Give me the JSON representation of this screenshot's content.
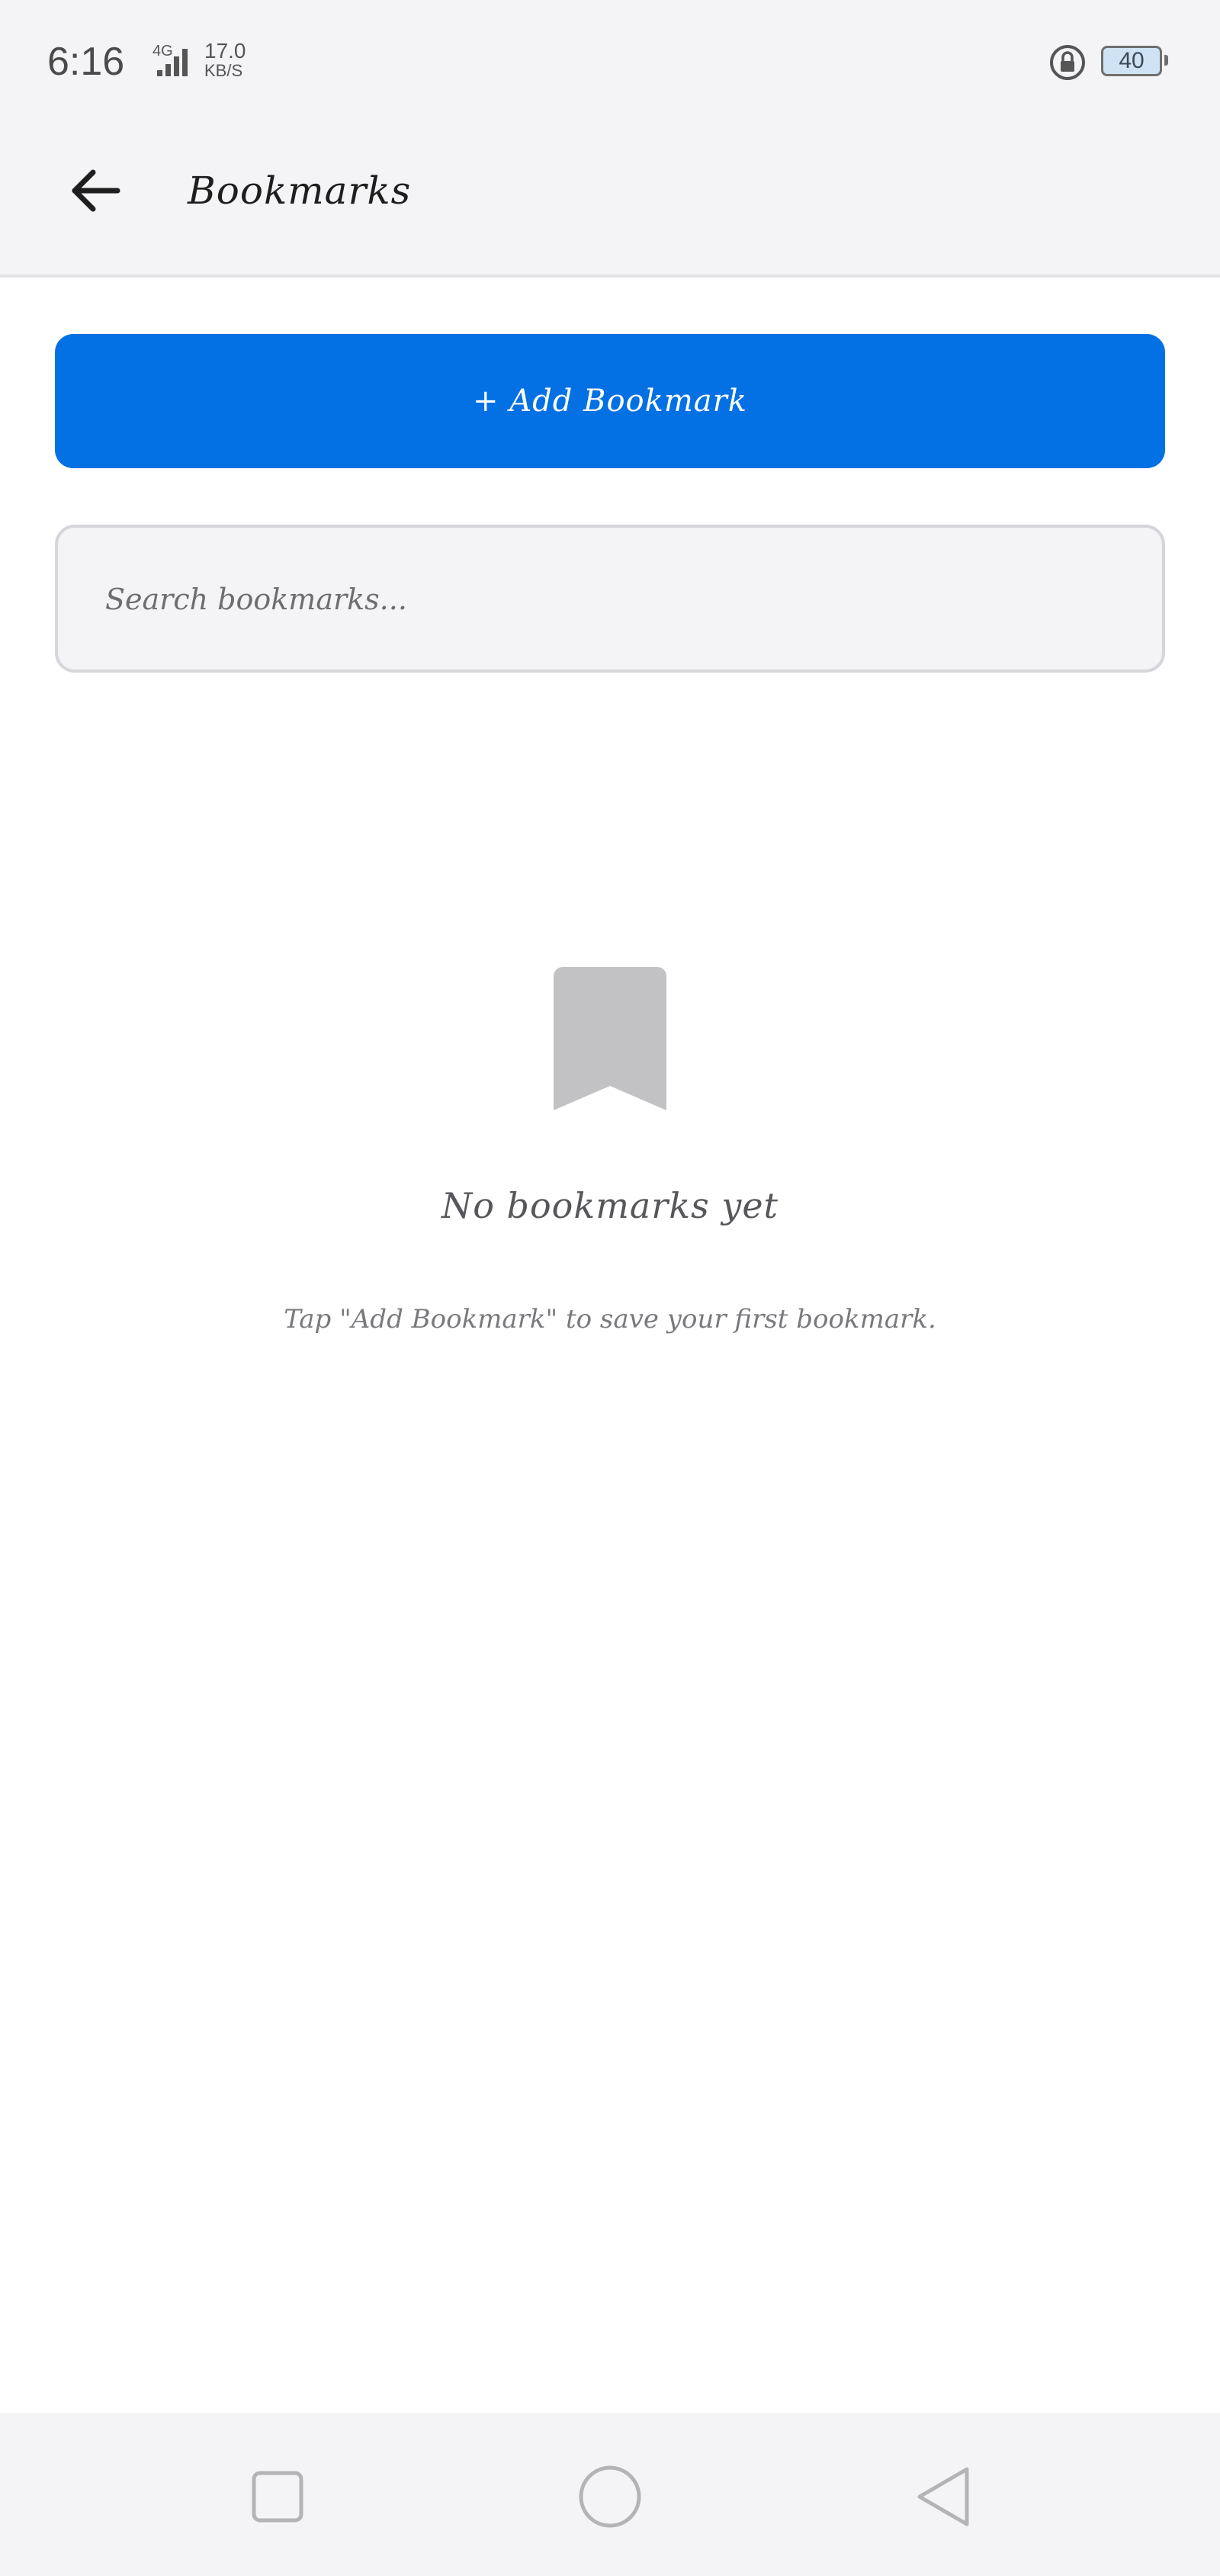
{
  "status_bar": {
    "time": "6:16",
    "network": "4G",
    "speed_value": "17.0",
    "speed_unit": "KB/S",
    "battery": "40"
  },
  "header": {
    "title": "Bookmarks",
    "back_icon": "arrow-left-icon"
  },
  "main": {
    "add_button_label": "+ Add Bookmark",
    "search_placeholder": "Search bookmarks...",
    "search_value": "",
    "empty_icon": "bookmark-icon",
    "empty_title": "No bookmarks yet",
    "empty_hint": "Tap \"Add Bookmark\" to save your first bookmark."
  },
  "nav_bar": {
    "recents_icon": "square-icon",
    "home_icon": "circle-icon",
    "back_icon": "triangle-back-icon"
  },
  "colors": {
    "accent": "#0370e3",
    "bar_background": "#f4f4f6",
    "empty_icon": "#c2c2c5"
  }
}
